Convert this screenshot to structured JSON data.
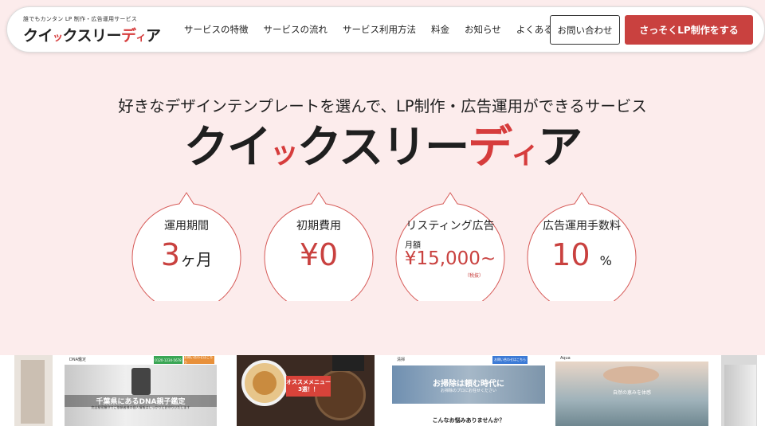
{
  "header": {
    "logo_tagline": "誰でもカンタン LP 制作・広告運用サービス",
    "logo_name_1": "クイ",
    "logo_name_2": "ッ",
    "logo_name_3": "クスリー",
    "logo_name_4": "デ",
    "logo_name_5": "ィ",
    "logo_name_6": "ア",
    "nav": [
      "サービスの特徴",
      "サービスの流れ",
      "サービス利用方法",
      "料金",
      "お知らせ",
      "よくある質問"
    ],
    "contact_label": "お問い合わせ",
    "cta_label": "さっそくLP制作をする"
  },
  "hero": {
    "tagline": "好きなデザインテンプレートを選んで、LP制作・広告運用ができるサービス",
    "logo_1": "クイ",
    "logo_2": "ッ",
    "logo_3": "クスリー",
    "logo_4": "デ",
    "logo_5": "ィ",
    "logo_6": "ア"
  },
  "features": [
    {
      "label": "運用期間",
      "value": "3",
      "unit": "ヶ月"
    },
    {
      "label": "初期費用",
      "value": "¥0"
    },
    {
      "label": "リスティング広告",
      "prefix": "月額",
      "value": "¥15,000~",
      "note": "（税抜）"
    },
    {
      "label": "広告運用手数料",
      "value": "10",
      "unit": "%"
    }
  ],
  "thumbnails": {
    "dna": {
      "site": "DNA鑑定",
      "phone": "0120-1234-5678",
      "cta": "お問い合わせはこちら",
      "title": "千葉県にあるDNA親子鑑定",
      "sub": "完全秘密厳守でご依頼者様の個人情報はしっかりとお守りいたします"
    },
    "ramen": {
      "badge": "オススメメニュー\n3選！！"
    },
    "clean": {
      "site": "清掃",
      "cta": "お問い合わせはこちら",
      "title": "お掃除は頼む時代に",
      "sub": "お掃除のプロにお任せください",
      "question": "こんなお悩みありませんか？"
    },
    "water": {
      "site": "Aqua",
      "caption": "自然の恵みを体感"
    }
  },
  "colors": {
    "accent": "#c9413f",
    "background": "#fcecec"
  }
}
